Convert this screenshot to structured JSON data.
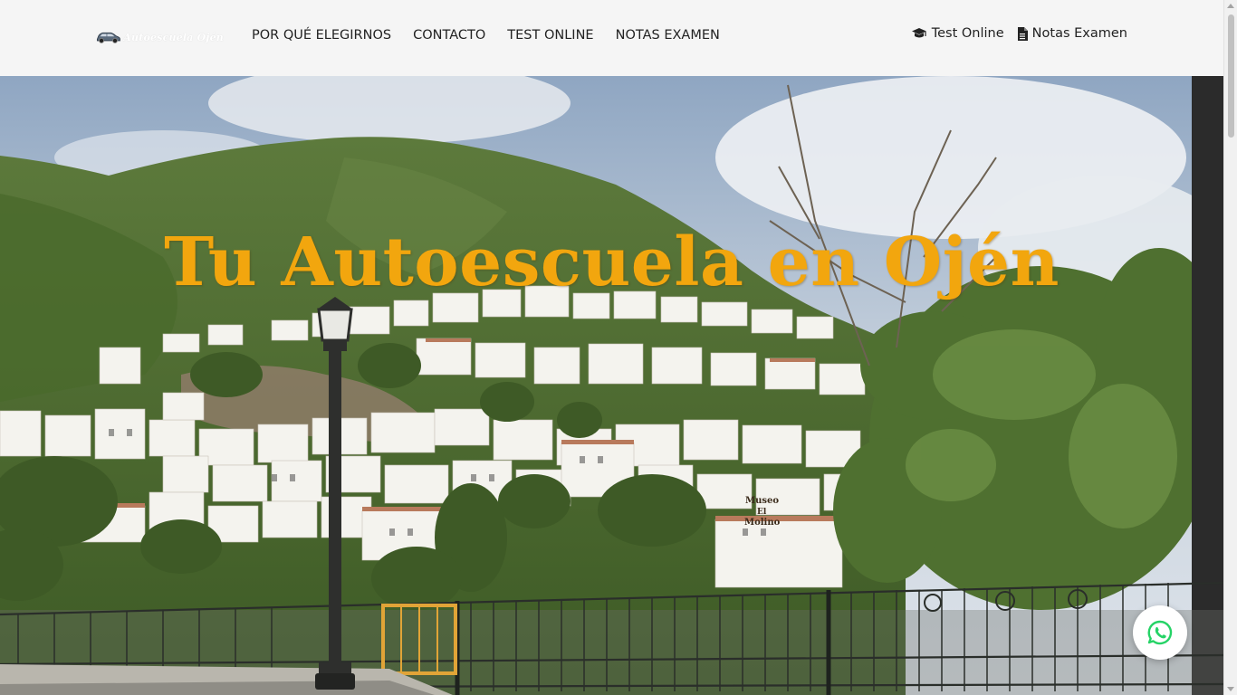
{
  "header": {
    "logo_text": "Autoescuela Ojén",
    "nav": [
      {
        "label": "POR QUÉ ELEGIRNOS"
      },
      {
        "label": "CONTACTO"
      },
      {
        "label": "TEST ONLINE"
      },
      {
        "label": "NOTAS EXAMEN"
      }
    ],
    "right_links": [
      {
        "label": "Test Online",
        "icon": "graduation-cap-icon"
      },
      {
        "label": "Notas Examen",
        "icon": "document-icon"
      }
    ]
  },
  "hero": {
    "title": "Tu Autoescuela en Ojén",
    "sign_text": "Museo El Molino"
  },
  "floating": {
    "whatsapp_icon": "whatsapp-icon"
  },
  "colors": {
    "title": "#f2a60e",
    "header_bg": "#f5f5f5",
    "whatsapp": "#25d366"
  }
}
